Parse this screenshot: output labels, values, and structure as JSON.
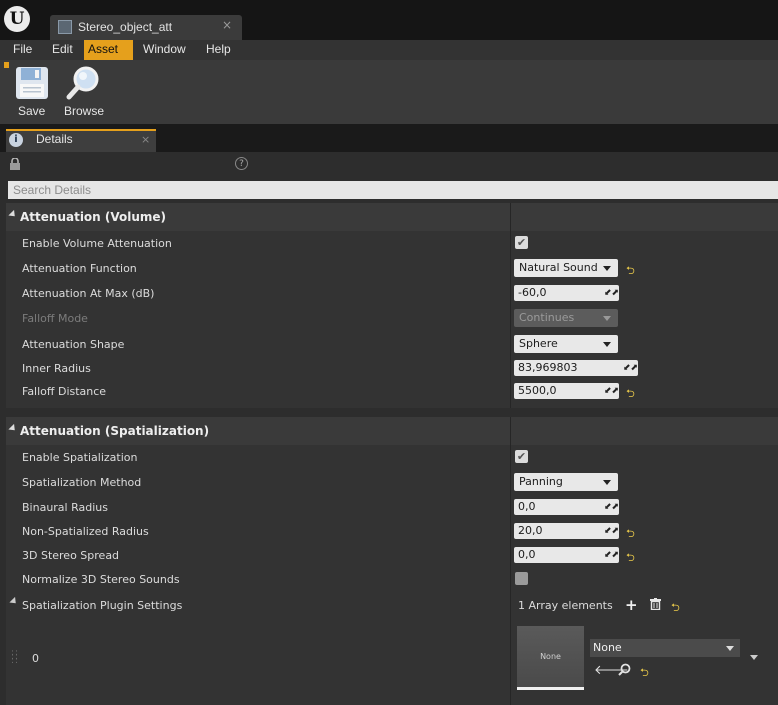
{
  "window": {
    "tab_title": "Stereo_object_att",
    "tab_close": "×",
    "logo": "U"
  },
  "menu": [
    "File",
    "Edit",
    "Asset",
    "Window",
    "Help"
  ],
  "toolbar": {
    "save": "Save",
    "browse": "Browse"
  },
  "panel": {
    "tab": "Details",
    "tab_close": "×",
    "search_placeholder": "Search Details",
    "help": "?"
  },
  "colors": {
    "accent": "#e5a01c",
    "reset_arrow": "#e9c94a"
  },
  "sections": {
    "volume": {
      "title": "Attenuation (Volume)",
      "enable_volume_attenuation": {
        "label": "Enable Volume Attenuation",
        "checked": true
      },
      "attenuation_function": {
        "label": "Attenuation Function",
        "value": "Natural Sound"
      },
      "attenuation_at_max": {
        "label": "Attenuation At Max (dB)",
        "value": "-60,0"
      },
      "falloff_mode": {
        "label": "Falloff Mode",
        "value": "Continues",
        "enabled": false
      },
      "attenuation_shape": {
        "label": "Attenuation Shape",
        "value": "Sphere"
      },
      "inner_radius": {
        "label": "Inner Radius",
        "value": "83,969803"
      },
      "falloff_distance": {
        "label": "Falloff Distance",
        "value": "5500,0"
      }
    },
    "spatialization": {
      "title": "Attenuation (Spatialization)",
      "enable_spatialization": {
        "label": "Enable Spatialization",
        "checked": true
      },
      "spatialization_method": {
        "label": "Spatialization Method",
        "value": "Panning"
      },
      "binaural_radius": {
        "label": "Binaural Radius",
        "value": "0,0"
      },
      "non_spatialized_radius": {
        "label": "Non-Spatialized Radius",
        "value": "20,0"
      },
      "stereo_spread": {
        "label": "3D Stereo Spread",
        "value": "0,0"
      },
      "normalize_stereo": {
        "label": "Normalize 3D Stereo Sounds",
        "checked": false
      },
      "plugin_settings": {
        "label": "Spatialization Plugin Settings",
        "count": "1 Array elements"
      },
      "element_0": {
        "index": "0",
        "thumbnail": "None",
        "asset": "None"
      }
    }
  }
}
